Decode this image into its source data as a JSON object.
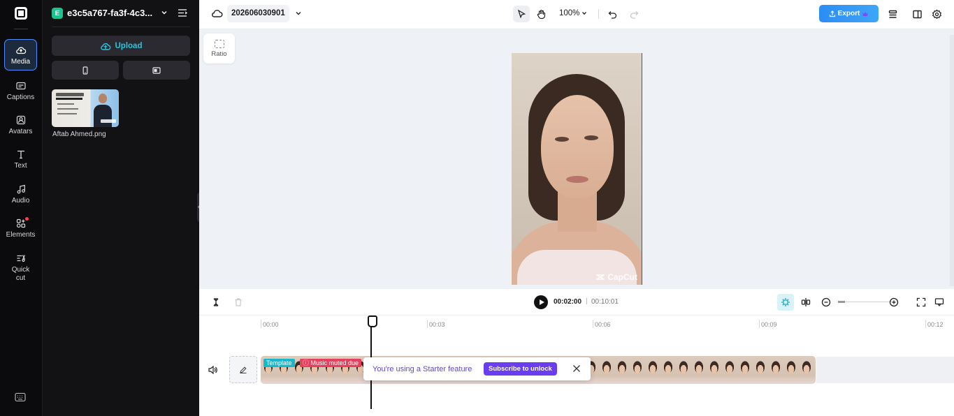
{
  "rail": {
    "items": [
      {
        "label": "Media",
        "icon": "cloud-upload-icon"
      },
      {
        "label": "Captions",
        "icon": "captions-icon"
      },
      {
        "label": "Avatars",
        "icon": "avatar-icon"
      },
      {
        "label": "Text",
        "icon": "text-icon"
      },
      {
        "label": "Audio",
        "icon": "music-note-icon"
      },
      {
        "label": "Elements",
        "icon": "elements-icon"
      },
      {
        "label": "Quick cut",
        "icon": "quick-cut-icon"
      }
    ]
  },
  "panel": {
    "project_badge": "E",
    "project_name": "e3c5a767-fa3f-4c3...",
    "upload_label": "Upload",
    "media_items": [
      {
        "name": "Aftab Ahmed.png"
      }
    ]
  },
  "topbar": {
    "project_title": "202606030901",
    "zoom": "100%",
    "export_label": "Export"
  },
  "canvas": {
    "ratio_label": "Ratio",
    "watermark": "CapCut"
  },
  "playback": {
    "current_time": "00:02:00",
    "separator": "|",
    "total_time": "00:10:01"
  },
  "timeline": {
    "ticks": [
      "00:00",
      "00:03",
      "00:06",
      "00:09",
      "00:12"
    ],
    "clip_template_label": "Template",
    "clip_muted_label": "ⓘ Music muted due",
    "toast_message": "You're using a Starter feature",
    "toast_button": "Subscribe to unlock"
  },
  "colors": {
    "accent_cyan": "#27c6e0",
    "export_blue": "#2e8cf5",
    "subscribe_purple": "#6b3df0",
    "muted_red": "#e5415e",
    "template_teal": "#16b9c9"
  }
}
